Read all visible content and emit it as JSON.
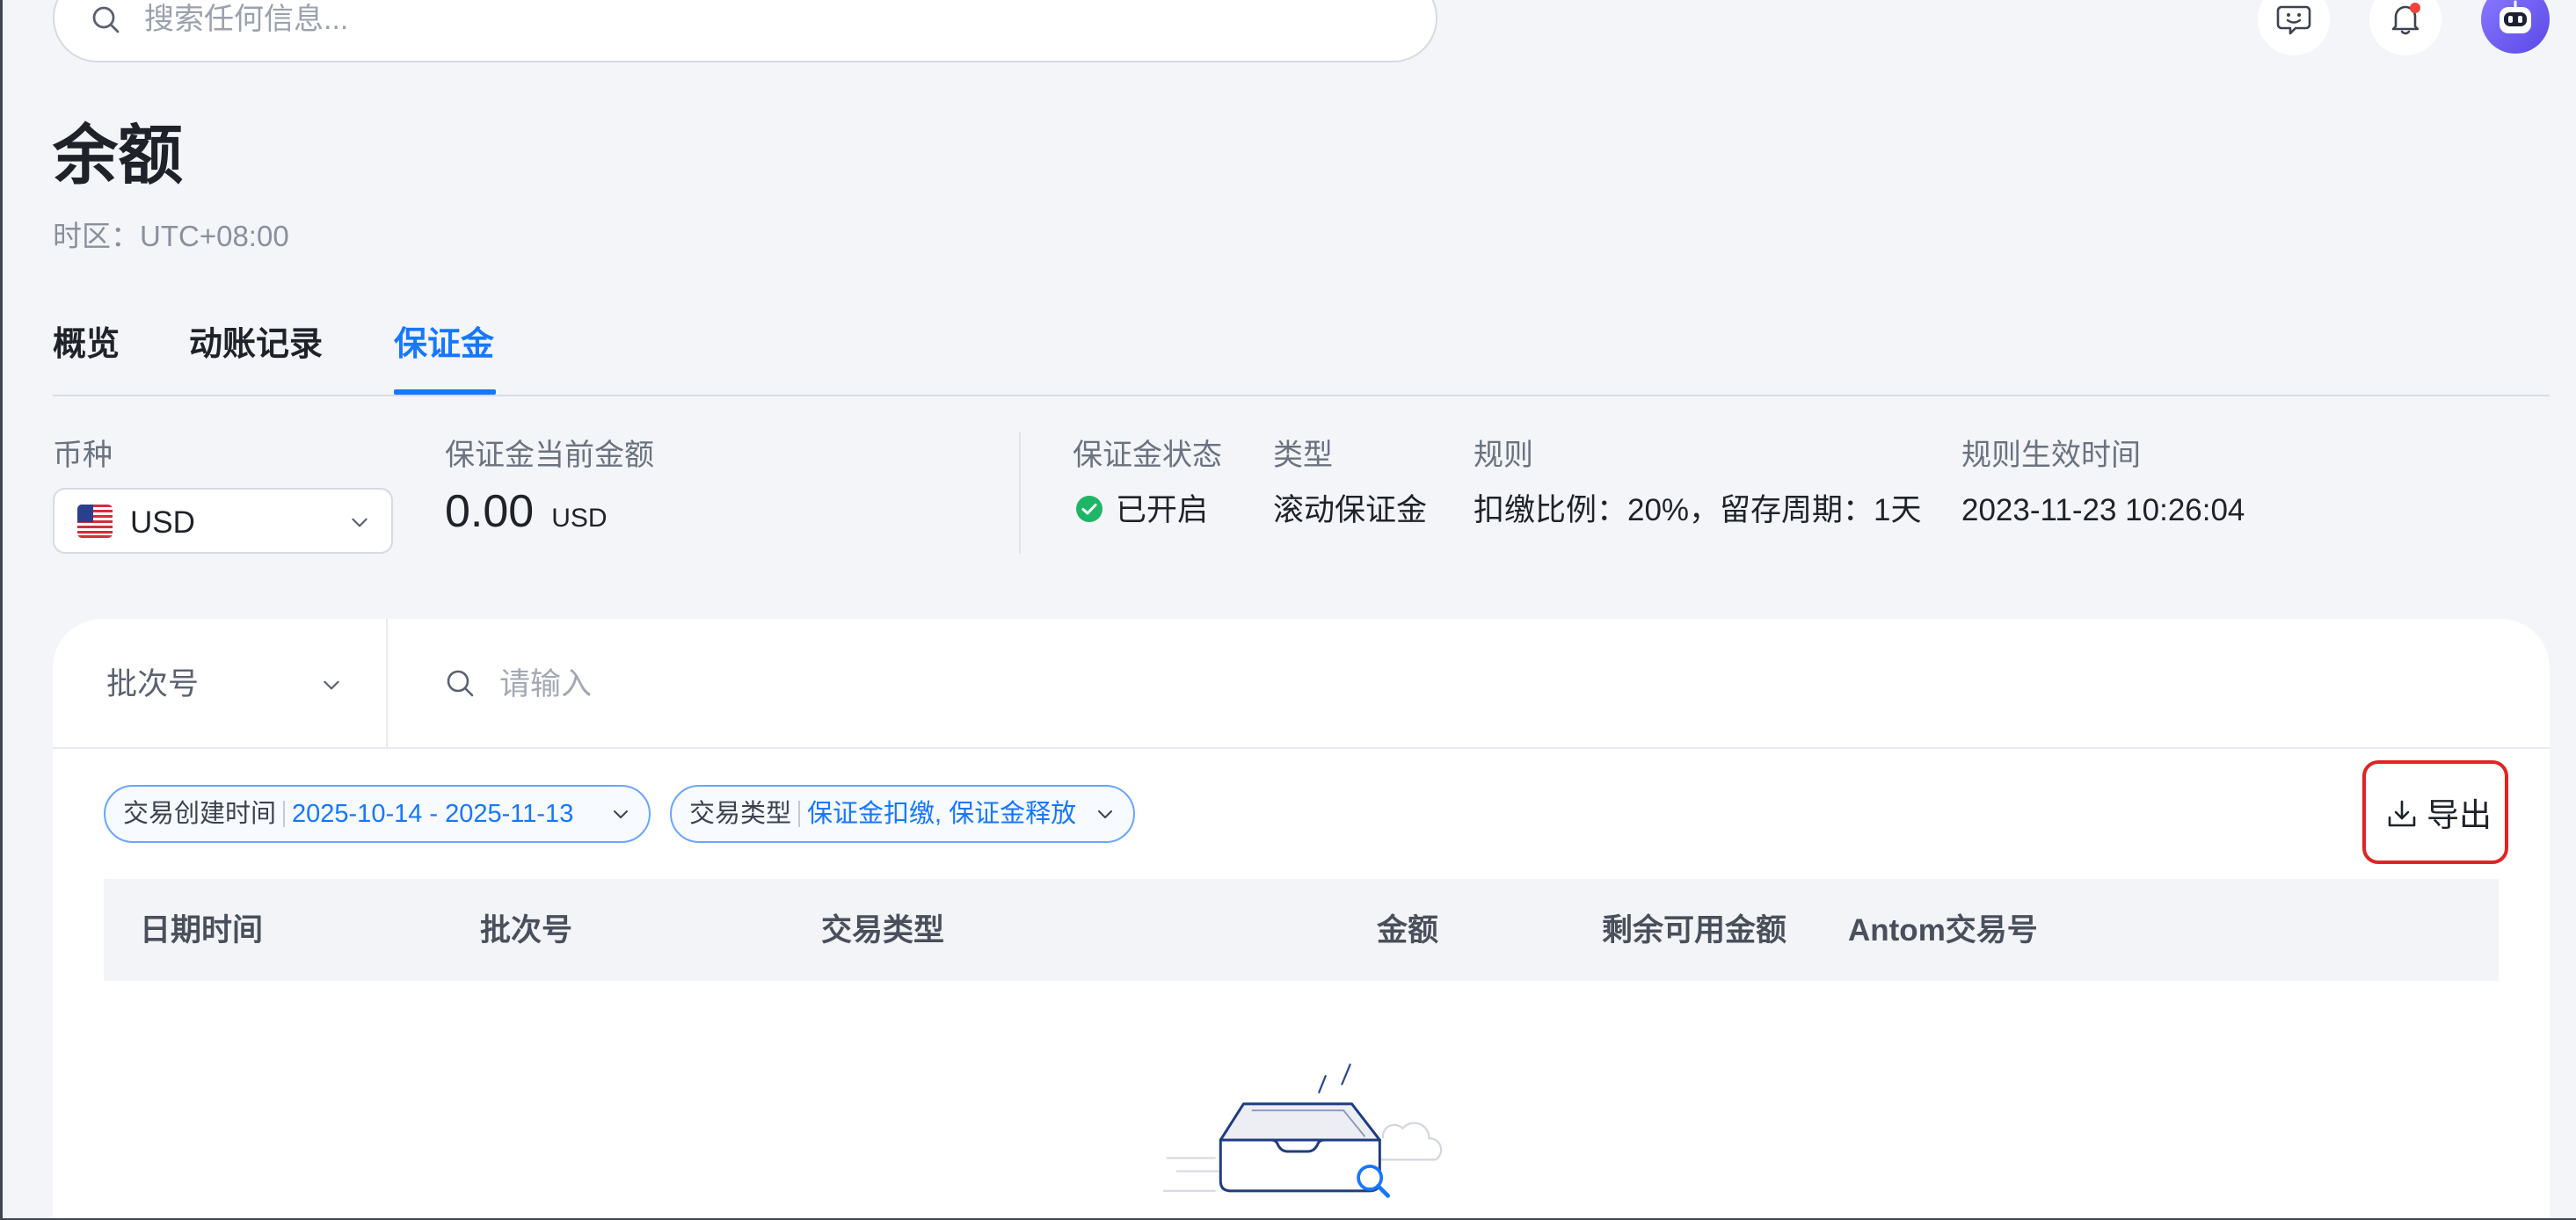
{
  "header": {
    "search_placeholder": "搜索任何信息...",
    "search_icon": "search-icon",
    "feedback_icon": "feedback-smile-icon",
    "notification_icon": "bell-icon",
    "has_notification_dot": true,
    "avatar_icon": "robot-avatar"
  },
  "page": {
    "title": "余额",
    "timezone": "时区：UTC+08:00"
  },
  "tabs": [
    {
      "label": "概览",
      "active": false
    },
    {
      "label": "动账记录",
      "active": false
    },
    {
      "label": "保证金",
      "active": true
    }
  ],
  "summary": {
    "currency": {
      "label": "币种",
      "value": "USD",
      "flag_icon": "us-flag-icon"
    },
    "amount": {
      "label": "保证金当前金额",
      "value": "0.00",
      "unit": "USD"
    },
    "status": {
      "label": "保证金状态",
      "value": "已开启",
      "icon": "check-circle-icon"
    },
    "type": {
      "label": "类型",
      "value": "滚动保证金"
    },
    "rule": {
      "label": "规则",
      "value": "扣缴比例：20%，留存周期：1天"
    },
    "effective_time": {
      "label": "规则生效时间",
      "value": "2023-11-23 10:26:04"
    }
  },
  "search": {
    "field": "批次号",
    "placeholder": "请输入"
  },
  "filters": [
    {
      "label": "交易创建时间",
      "value": "2025-10-14 - 2025-11-13"
    },
    {
      "label": "交易类型",
      "value": "保证金扣缴, 保证金释放"
    }
  ],
  "export": {
    "label": "导出",
    "icon": "download-icon"
  },
  "table": {
    "columns": [
      "日期时间",
      "批次号",
      "交易类型",
      "金额",
      "剩余可用金额",
      "Antom交易号"
    ]
  },
  "colors": {
    "accent": "#1677ff",
    "page_bg": "#f3f5f9",
    "success": "#1fb567",
    "highlight_border": "#e02424",
    "notification_dot": "#f0433b"
  }
}
